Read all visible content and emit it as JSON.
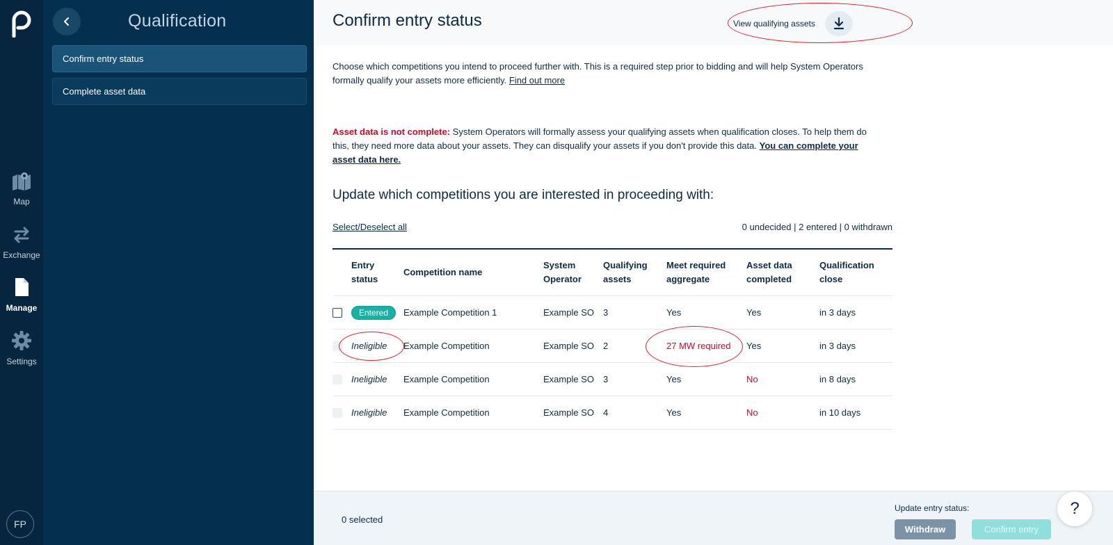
{
  "rail": {
    "items": [
      {
        "label": "Map",
        "icon": "map-icon"
      },
      {
        "label": "Exchange",
        "icon": "exchange-icon"
      },
      {
        "label": "Manage",
        "icon": "document-icon"
      },
      {
        "label": "Settings",
        "icon": "gear-icon"
      }
    ],
    "avatar": "FP"
  },
  "sidebar": {
    "title": "Qualification",
    "items": [
      {
        "label": "Confirm entry status",
        "active": true
      },
      {
        "label": "Complete asset data",
        "active": false
      }
    ]
  },
  "header": {
    "title": "Confirm entry status",
    "view_assets_label": "View qualifying assets"
  },
  "intro": {
    "text": "Choose which competitions you intend to proceed further with.",
    "strong": " This is a required step prior to bidding and will help System Operators formally qualify your assets more efficiently.",
    "link": "Find out more"
  },
  "warning": {
    "label": "Asset data is not complete:",
    "text": " System Operators will formally assess your qualifying assets when qualification closes. To help them do this, they need more data about your assets. They can disqualify your assets if you don't provide this data.",
    "link": "You can complete your asset data here."
  },
  "section_title": "Update which competitions you are interested in proceeding with:",
  "select_all": "Select/Deselect all",
  "counts": "0 undecided | 2 entered | 0 withdrawn",
  "table": {
    "headers": {
      "entry_status_1": "Entry",
      "entry_status_2": "status",
      "name": "Competition name",
      "so_1": "System",
      "so_2": "Operator",
      "qa_1": "Qualifying",
      "qa_2": "assets",
      "agg_1": "Meet required",
      "agg_2": "aggregate",
      "data_1": "Asset data",
      "data_2": "completed",
      "close_1": "Qualification",
      "close_2": "close"
    },
    "rows": [
      {
        "status": "Entered",
        "name": "Example Competition 1",
        "so": "Example SO",
        "qa": "3",
        "agg": "Yes",
        "data": "Yes",
        "close": "in 3 days"
      },
      {
        "status": "Ineligible",
        "name": "Example Competition",
        "so": "Example SO",
        "qa": "2",
        "agg": "27 MW required",
        "data": "Yes",
        "close": "in 3 days"
      },
      {
        "status": "Ineligible",
        "name": "Example Competition",
        "so": "Example SO",
        "qa": "3",
        "agg": "Yes",
        "data": "No",
        "close": "in 8 days"
      },
      {
        "status": "Ineligible",
        "name": "Example Competition",
        "so": "Example SO",
        "qa": "4",
        "agg": "Yes",
        "data": "No",
        "close": "in 10 days"
      }
    ]
  },
  "footer": {
    "selected": "0 selected",
    "update_label": "Update entry status:",
    "withdraw": "Withdraw",
    "confirm": "Confirm entry",
    "help": "?"
  },
  "colors": {
    "rail_bg": "#06263f",
    "sidebar_bg": "#052f4e",
    "accent_teal": "#16b3a5",
    "alert_red": "#d90429",
    "annotation_red": "#e01b24"
  }
}
